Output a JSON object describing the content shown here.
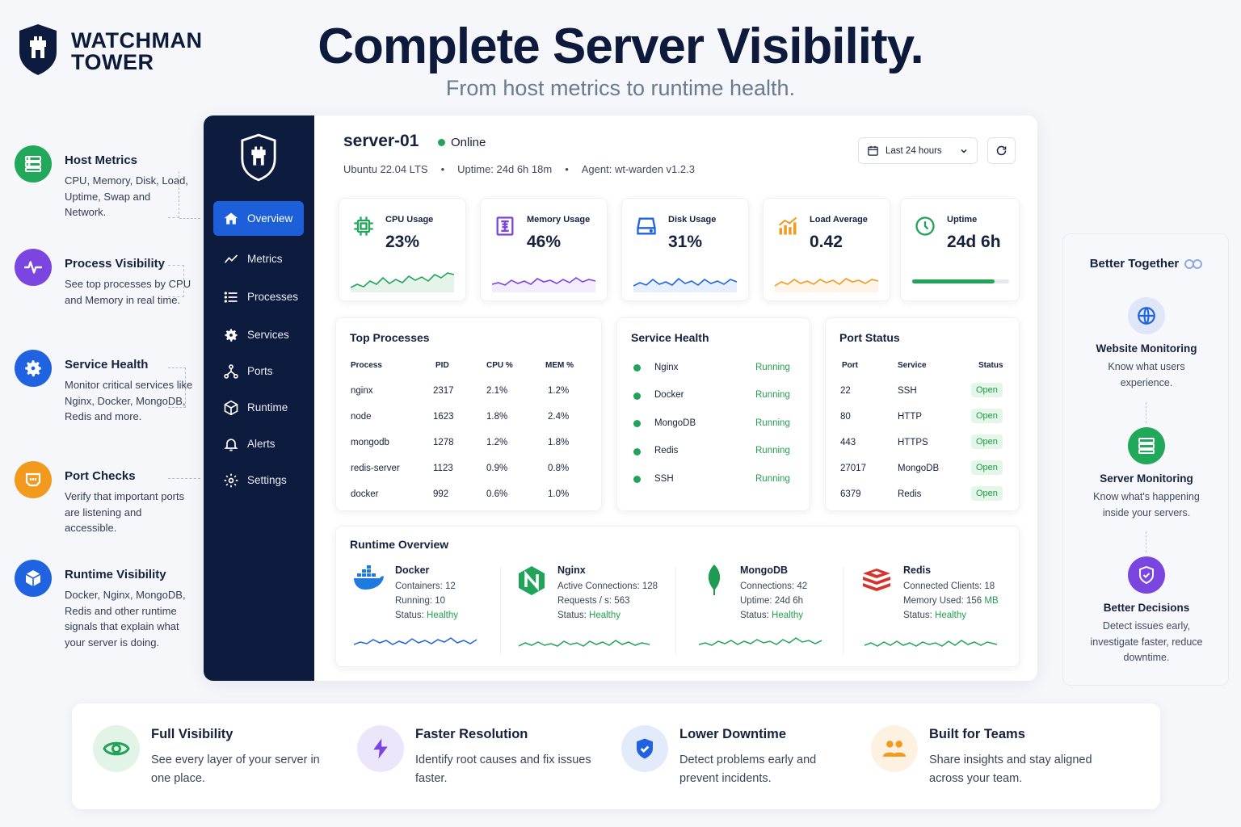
{
  "brand": {
    "line1": "WATCHMAN",
    "line2": "TOWER",
    "logo_icon": "shield-tower-icon"
  },
  "hero": {
    "title": "Complete Server Visibility.",
    "subtitle": "From host metrics to runtime health."
  },
  "features": [
    {
      "title": "Host Metrics",
      "desc": "CPU, Memory, Disk, Load, Uptime, Swap and Network.",
      "icon": "server-icon",
      "color": "#21a85a"
    },
    {
      "title": "Process Visibility",
      "desc": "See top processes by CPU and Memory in real time.",
      "icon": "pulse-icon",
      "color": "#7b45e0"
    },
    {
      "title": "Service Health",
      "desc": "Monitor critical services like Nginx, Docker, MongoDB, Redis and more.",
      "icon": "gear-icon",
      "color": "#1f63e0"
    },
    {
      "title": "Port Checks",
      "desc": "Verify that important ports are listening and accessible.",
      "icon": "port-icon",
      "color": "#f29a1e"
    },
    {
      "title": "Runtime Visibility",
      "desc": "Docker, Nginx, MongoDB, Redis and other runtime signals that explain what your server is doing.",
      "icon": "cube-icon",
      "color": "#1f63e0"
    }
  ],
  "sidebar": {
    "items": [
      {
        "label": "Overview",
        "icon": "home-icon"
      },
      {
        "label": "Metrics",
        "icon": "trend-icon"
      },
      {
        "label": "Processes",
        "icon": "list-icon"
      },
      {
        "label": "Services",
        "icon": "gear-icon"
      },
      {
        "label": "Ports",
        "icon": "network-icon"
      },
      {
        "label": "Runtime",
        "icon": "cube-icon"
      },
      {
        "label": "Alerts",
        "icon": "bell-icon"
      },
      {
        "label": "Settings",
        "icon": "settings-icon"
      }
    ]
  },
  "server": {
    "name": "server-01",
    "status": "Online",
    "os": "Ubuntu 22.04 LTS",
    "uptime": "Uptime: 24d 6h 18m",
    "agent": "Agent: wt-warden v1.2.3",
    "separator": "•",
    "time_range": "Last 24 hours"
  },
  "metrics": [
    {
      "label": "CPU Usage",
      "value": "23%",
      "icon": "cpu-icon",
      "color": "#22a35a"
    },
    {
      "label": "Memory Usage",
      "value": "46%",
      "icon": "memory-icon",
      "color": "#7b45e0"
    },
    {
      "label": "Disk Usage",
      "value": "31%",
      "icon": "disk-icon",
      "color": "#1f63e0"
    },
    {
      "label": "Load Average",
      "value": "0.42",
      "icon": "bar-chart-icon",
      "color": "#f29a1e"
    },
    {
      "label": "Uptime",
      "value": "24d 6h",
      "icon": "clock-icon",
      "color": "#22a35a",
      "progress": 0.85
    }
  ],
  "top_processes": {
    "title": "Top Processes",
    "headers": [
      "Process",
      "PID",
      "CPU %",
      "MEM %"
    ],
    "rows": [
      [
        "nginx",
        "2317",
        "2.1%",
        "1.2%"
      ],
      [
        "node",
        "1623",
        "1.8%",
        "2.4%"
      ],
      [
        "mongodb",
        "1278",
        "1.2%",
        "1.8%"
      ],
      [
        "redis-server",
        "1123",
        "0.9%",
        "0.8%"
      ],
      [
        "docker",
        "992",
        "0.6%",
        "1.0%"
      ]
    ]
  },
  "service_health": {
    "title": "Service Health",
    "rows": [
      {
        "name": "Nginx",
        "status": "Running"
      },
      {
        "name": "Docker",
        "status": "Running"
      },
      {
        "name": "MongoDB",
        "status": "Running"
      },
      {
        "name": "Redis",
        "status": "Running"
      },
      {
        "name": "SSH",
        "status": "Running"
      }
    ]
  },
  "port_status": {
    "title": "Port Status",
    "headers": [
      "Port",
      "Service",
      "Status"
    ],
    "rows": [
      [
        "22",
        "SSH",
        "Open"
      ],
      [
        "80",
        "HTTP",
        "Open"
      ],
      [
        "443",
        "HTTPS",
        "Open"
      ],
      [
        "27017",
        "MongoDB",
        "Open"
      ],
      [
        "6379",
        "Redis",
        "Open"
      ]
    ]
  },
  "runtime": {
    "title": "Runtime Overview",
    "status_label": "Status:",
    "items": [
      {
        "name": "Docker",
        "line1": "Containers: 12",
        "line2": "Running: 10",
        "status": "Healthy",
        "icon": "docker-icon",
        "color": "#1f63e0"
      },
      {
        "name": "Nginx",
        "line1": "Active Connections: 128",
        "line2": "Requests / s: 563",
        "status": "Healthy",
        "icon": "nginx-icon",
        "color": "#22a35a"
      },
      {
        "name": "MongoDB",
        "line1": "Connections: 42",
        "line2": "Uptime: 24d 6h",
        "status": "Healthy",
        "icon": "leaf-icon",
        "color": "#22a35a"
      },
      {
        "name": "Redis",
        "line1": "Connected Clients: 18",
        "line2_prefix": "Memory Used: 156",
        "line2_unit": "MB",
        "status": "Healthy",
        "icon": "redis-icon",
        "color": "#22a35a"
      }
    ]
  },
  "better_together": {
    "title": "Better Together",
    "items": [
      {
        "title": "Website Monitoring",
        "desc": "Know what users experience.",
        "icon": "globe-icon"
      },
      {
        "title": "Server Monitoring",
        "desc": "Know what's happening inside your servers.",
        "icon": "server-icon"
      },
      {
        "title": "Better Decisions",
        "desc": "Detect issues early, investigate faster, reduce downtime.",
        "icon": "shield-check-icon"
      }
    ]
  },
  "benefits": [
    {
      "title": "Full Visibility",
      "desc": "See every layer of your server in one place.",
      "icon": "eye-icon"
    },
    {
      "title": "Faster Resolution",
      "desc": "Identify root causes and fix issues faster.",
      "icon": "bolt-icon"
    },
    {
      "title": "Lower Downtime",
      "desc": "Detect problems early and prevent incidents.",
      "icon": "shield-check-icon"
    },
    {
      "title": "Built for Teams",
      "desc": "Share insights and stay aligned across your team.",
      "icon": "team-icon"
    }
  ]
}
